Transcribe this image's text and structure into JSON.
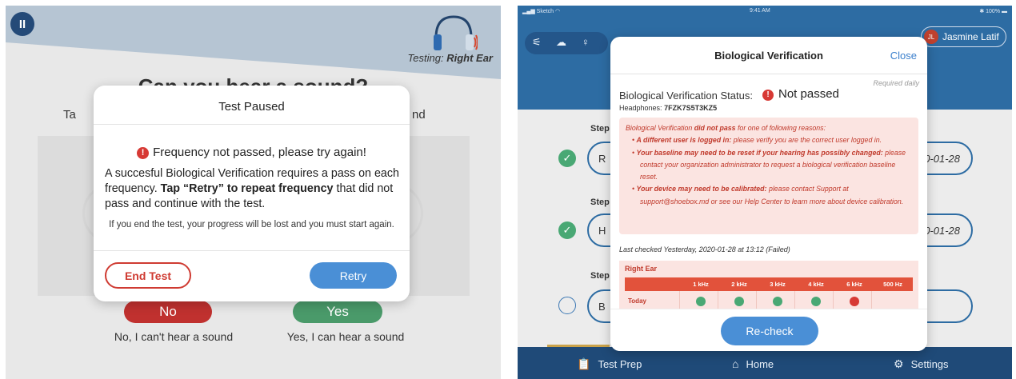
{
  "left": {
    "testing_prefix": "Testing:",
    "testing_ear": "Right Ear",
    "bg_question": "Can you hear a sound?",
    "bg_sub_left": "Ta",
    "bg_sub_right": "nd",
    "no_label": "No",
    "yes_label": "Yes",
    "no_caption": "No, I can't hear a sound",
    "yes_caption": "Yes, I can hear a sound",
    "dialog": {
      "title": "Test Paused",
      "fail_text": "Frequency not passed, please try again!",
      "body_before": "A succesful Biological Verification requires a pass on each frequency. ",
      "body_bold": "Tap “Retry” to repeat frequency",
      "body_after": " that did not pass and continue with the test.",
      "note": "If you end the test, your progress will be lost and you must start again.",
      "end_label": "End Test",
      "retry_label": "Retry"
    }
  },
  "right": {
    "status": {
      "left": "Sketch",
      "time": "9:41 AM",
      "battery": "100%"
    },
    "user": {
      "initials": "JL",
      "name": "Jasmine Latif"
    },
    "steps": [
      {
        "label": "Step",
        "pill_left": "R",
        "pill_right": "0-01-28",
        "state": "done"
      },
      {
        "label": "Step",
        "pill_left": "H",
        "pill_right": "0-01-28",
        "state": "done"
      },
      {
        "label": "Step",
        "pill_left": "B",
        "pill_right": "",
        "state": "todo"
      }
    ],
    "nav": [
      {
        "label": "Test Prep",
        "icon": "clipboard-icon"
      },
      {
        "label": "Home",
        "icon": "home-icon"
      },
      {
        "label": "Settings",
        "icon": "gear-icon"
      }
    ],
    "dialog": {
      "title": "Biological Verification",
      "close_label": "Close",
      "required": "Required daily",
      "status_label": "Biological Verification Status:",
      "status_value": "Not passed",
      "headphones_label": "Headphones:",
      "headphones_value": "7FZK7S5T3KZ5",
      "reasons_intro_a": "Biological Verification ",
      "reasons_intro_b": "did not pass",
      "reasons_intro_c": " for one of following reasons:",
      "reasons": [
        {
          "bold": "A different user is logged in:",
          "text": " please verify you are the correct user logged in."
        },
        {
          "bold": "Your baseline may need to be reset if your hearing has possibly changed:",
          "text": " please contact your organization administrator to request a biological verification baseline reset."
        },
        {
          "bold": "Your device may need to be calibrated:",
          "text": " please contact Support at support@shoebox.md or see our Help Center to learn more about device calibration."
        }
      ],
      "last_checked": "Last checked Yesterday, 2020-01-28 at 13:12 (Failed)",
      "ear_label": "Right Ear",
      "freqs": [
        "1 kHz",
        "2 kHz",
        "3 kHz",
        "4 kHz",
        "6 kHz",
        "500 Hz"
      ],
      "row_label": "Today",
      "results": [
        "pass",
        "pass",
        "pass",
        "pass",
        "fail",
        "none"
      ],
      "recheck_label": "Re-check"
    }
  }
}
